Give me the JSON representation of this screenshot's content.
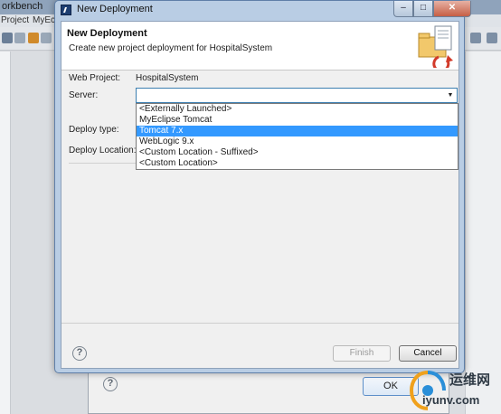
{
  "background": {
    "title_fragment": "orkbench",
    "menu": [
      "Project",
      "MyEc"
    ],
    "dialog_ok_label": "OK"
  },
  "window": {
    "title": "New Deployment",
    "controls": {
      "minimize": "–",
      "maximize": "□",
      "close": "✕"
    }
  },
  "header": {
    "title": "New Deployment",
    "description": "Create new project deployment for HospitalSystem"
  },
  "form": {
    "web_project_label": "Web Project:",
    "web_project_value": "HospitalSystem",
    "server_label": "Server:",
    "server_value": "",
    "deploy_type_label": "Deploy type:",
    "deploy_location_label": "Deploy Location:"
  },
  "dropdown": {
    "options": [
      "<Externally Launched>",
      "MyEclipse Tomcat",
      "Tomcat  7.x",
      "WebLogic  9.x",
      "<Custom Location - Suffixed>",
      "<Custom Location>"
    ],
    "selected_index": 2
  },
  "footer": {
    "help": "?",
    "finish_label": "Finish",
    "cancel_label": "Cancel"
  },
  "watermark": {
    "name": "运维网",
    "domain": "iyunv.com"
  },
  "colors": {
    "selection": "#3399ff",
    "frame": "#b9cde4",
    "combo_border": "#3c7fb1"
  }
}
